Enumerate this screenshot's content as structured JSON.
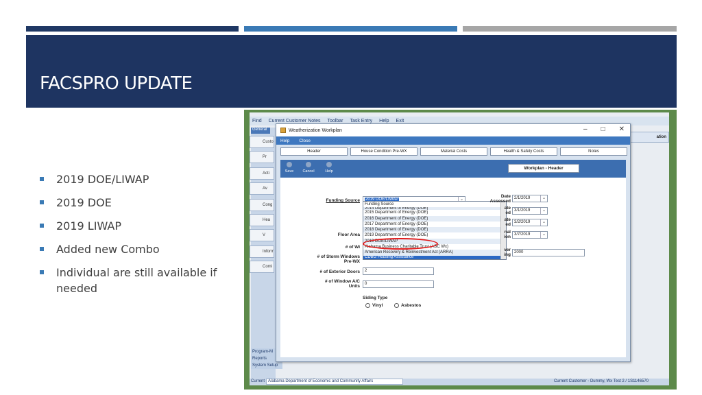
{
  "slide": {
    "title": "FACSPRO UPDATE",
    "bullets": [
      "2019 DOE/LIWAP",
      "2019 DOE",
      "2019 LIWAP",
      "Added new Combo",
      "Individual are still available if needed"
    ],
    "accent_colors": {
      "dark_blue": "#1e3461",
      "mid_blue": "#3a7ab5",
      "gray": "#a6a6a6"
    }
  },
  "app": {
    "top_menu": [
      "Find",
      "Current Customer Notes",
      "Toolbar",
      "Task Entry",
      "Help",
      "Exit"
    ],
    "sidebar_tab": "General",
    "sidebar_items": [
      "Custo",
      "Pr",
      "Acti",
      "Av",
      "Cong",
      "Hea",
      "V",
      "Informa",
      "Comi"
    ],
    "sidebar_bottom": [
      "Program-M",
      "Reports",
      "System Setup"
    ],
    "right_pane_label": "ation",
    "status_bar": {
      "cca_label": "Current CAA",
      "cca_value": "Alabama Department of Economic and Community Affairs",
      "customer": "Current Customer - Dummy, Wx Test 2 / 1S1146570"
    }
  },
  "window": {
    "title": "Weatherization Workplan",
    "menu": [
      "Help",
      "Close"
    ],
    "controls": [
      "–",
      "□",
      "✕"
    ],
    "tabs": [
      "Header",
      "House Condition Pre-WX",
      "Material Costs",
      "Health & Safety Costs",
      "Notes"
    ],
    "toolbar_buttons": [
      "Save",
      "Cancel",
      "Help"
    ],
    "section_title": "Workplan - Header",
    "form": {
      "funding_source_label": "Funding Source",
      "funding_source_value": "2019 DOE/LIWAP",
      "floor_area_label": "Floor Area",
      "num_windows_label": "# of Wi",
      "storm_windows_label": "# of Storm Windows Pre-WX",
      "exterior_doors_label": "# of Exterior Doors",
      "exterior_doors_value": "2",
      "window_ac_label": "# of Window A/C Units",
      "window_ac_value": "0",
      "siding_type_label": "Siding Type",
      "siding_options": [
        "Vinyl",
        "Asbestos"
      ],
      "date_assessed_label": "Date Assessed",
      "date_assessed_value": "2/1/2019",
      "date2_label": "ate ed",
      "date2_value": "3/1/2019",
      "date3_label": "ate ed",
      "date3_value": "3/2/2019",
      "date4_label": "nal ion",
      "date4_value": "3/7/2019",
      "year_label": "ver ing",
      "year_value": "2000"
    },
    "dropdown_items": [
      "Funding Source",
      "2014 Department of Energy (DOE)",
      "2015 Department of Energy (DOE)",
      "2016 Department of Energy (DOE)",
      "2017 Department of Energy (DOE)",
      "2018 Department of Energy (DOE)",
      "2019 Department of Energy (DOE)",
      "2019 DOE/LIWAP",
      "Alabama Business Charitable Trust (ABC Wx)",
      "American Recovery & Reinvestment Act (ARRA)",
      "CDBG Housing Assistance"
    ]
  }
}
